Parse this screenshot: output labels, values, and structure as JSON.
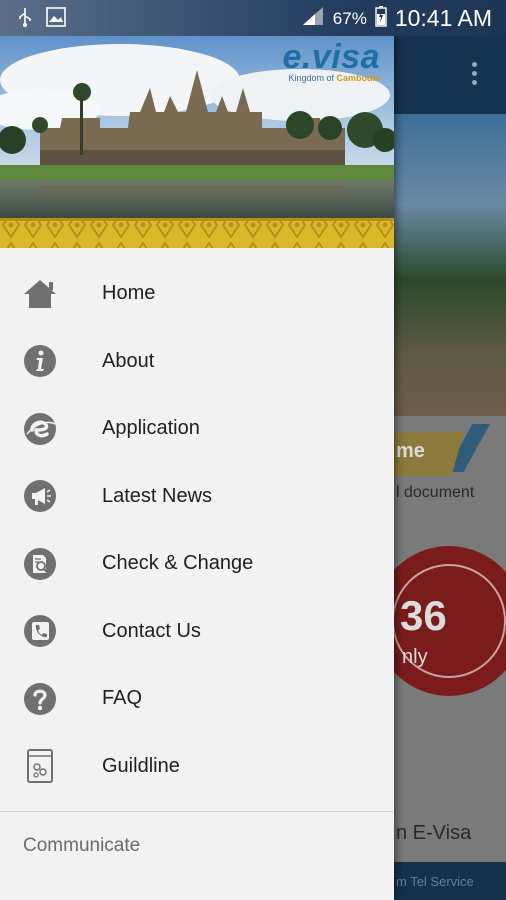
{
  "status_bar": {
    "battery": "67%",
    "time": "10:41 AM"
  },
  "logo": {
    "main": "e.visa",
    "sub_prefix": "Kingdom of ",
    "sub_strong": "Cambodia"
  },
  "menu": {
    "items": [
      {
        "label": "Home",
        "icon": "home-icon"
      },
      {
        "label": "About",
        "icon": "info-icon"
      },
      {
        "label": "Application",
        "icon": "e-icon"
      },
      {
        "label": "Latest News",
        "icon": "megaphone-icon"
      },
      {
        "label": "Check & Change",
        "icon": "document-search-icon"
      },
      {
        "label": "Contact Us",
        "icon": "phone-icon"
      },
      {
        "label": "FAQ",
        "icon": "question-icon"
      },
      {
        "label": "Guildline",
        "icon": "guide-book-icon"
      }
    ],
    "section_title": "Communicate"
  },
  "background": {
    "banner": "me",
    "doc_text": "l document",
    "seal_number": "36",
    "seal_text": "nly",
    "evisa_text": "n E-Visa",
    "footer_text": "m Tel Service"
  },
  "colors": {
    "drawer_bg": "#f2f2f2",
    "icon_gray": "#707070",
    "brand_blue": "#1d6fa5",
    "gold": "#d9b92a"
  }
}
